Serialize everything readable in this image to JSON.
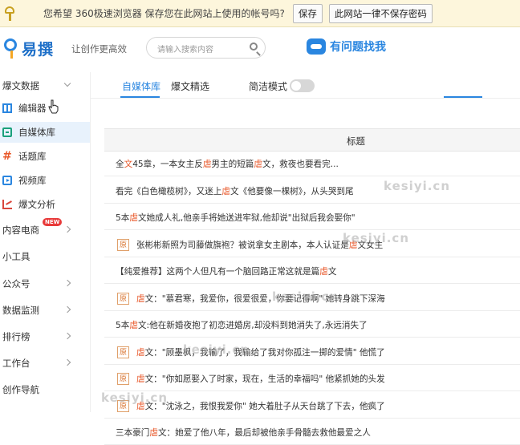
{
  "password_bar": {
    "message": "您希望 360极速浏览器 保存您在此网站上使用的帐号吗?",
    "save_label": "保存",
    "never_label": "此网站一律不保存密码"
  },
  "header": {
    "logo_text": "易撰",
    "slogan": "让创作更高效",
    "search_placeholder": "请输入搜索内容",
    "help_label": "有问题找我"
  },
  "sidebar": {
    "items": [
      {
        "label": "爆文数据"
      },
      {
        "label": "编辑器"
      },
      {
        "label": "自媒体库"
      },
      {
        "label": "话题库"
      },
      {
        "label": "视频库"
      },
      {
        "label": "爆文分析"
      },
      {
        "label": "内容电商",
        "badge": "NEW"
      },
      {
        "label": "小工具"
      },
      {
        "label": "公众号"
      },
      {
        "label": "数据监测"
      },
      {
        "label": "排行榜"
      },
      {
        "label": "工作台"
      },
      {
        "label": "创作导航"
      }
    ]
  },
  "tabs": {
    "items": [
      "自媒体库",
      "爆文精选"
    ],
    "mode_label": "简洁模式"
  },
  "table": {
    "column_title": "标题",
    "rows": [
      {
        "tag": "",
        "parts": [
          "全",
          "文",
          "45章，一本女主反",
          "虐",
          "男主的短篇",
          "虐",
          "文，救夜也要看完..."
        ]
      },
      {
        "tag": "",
        "parts": [
          "看完《白色橄榄树》，又迷上",
          "虐",
          "文《他要像一棵树》，从头哭到尾",
          "",
          ""
        ]
      },
      {
        "tag": "",
        "parts": [
          "5本",
          "虐",
          "文她成人礼,他亲手将她送进牢狱,他却说\"出狱后我会娶你\"",
          "",
          ""
        ]
      },
      {
        "tag": "原",
        "parts": [
          "张彬彬新照为司藤做旗袍？被说拿女主剧本，本人认证是",
          "虐",
          "文女主",
          "",
          ""
        ]
      },
      {
        "tag": "",
        "parts": [
          "【纯爱推荐】这两个人但凡有一个脑回路正常这就是篇",
          "虐",
          "文",
          "",
          ""
        ]
      },
      {
        "tag": "原",
        "parts": [
          "",
          "虐",
          "文：\"慕君寒，我爱你，很爱很爱，你要记得啊\" 她转身跳下深海",
          "",
          ""
        ]
      },
      {
        "tag": "",
        "parts": [
          "5本",
          "虐",
          "文:他在新婚夜抱了初恋进婚房,却没料到她消失了,永远消失了",
          "",
          ""
        ]
      },
      {
        "tag": "原",
        "parts": [
          "",
          "虐",
          "文：\"顾墨枫，我输了，我输给了我对你孤注一掷的爱情\" 他慌了",
          "",
          ""
        ]
      },
      {
        "tag": "原",
        "parts": [
          "",
          "虐",
          "文：\"你如愿娶入了时家，现在，生活的幸福吗\" 他紧抓她的头发",
          "",
          ""
        ]
      },
      {
        "tag": "原",
        "parts": [
          "",
          "虐",
          "文：\"沈泳之，我恨我爱你\" 她大着肚子从天台跳了下去，他疯了",
          "",
          ""
        ]
      },
      {
        "tag": "",
        "parts": [
          "三本豪门",
          "虐",
          "文：她爱了他八年，最后却被他亲手骨髓去救他最爱之人",
          "",
          ""
        ]
      }
    ]
  },
  "watermark": "kesiyi.cn",
  "colors": {
    "accent": "#2a86e0",
    "highlight": "#e8582a",
    "password_bar_bg": "#fdf6dc"
  }
}
